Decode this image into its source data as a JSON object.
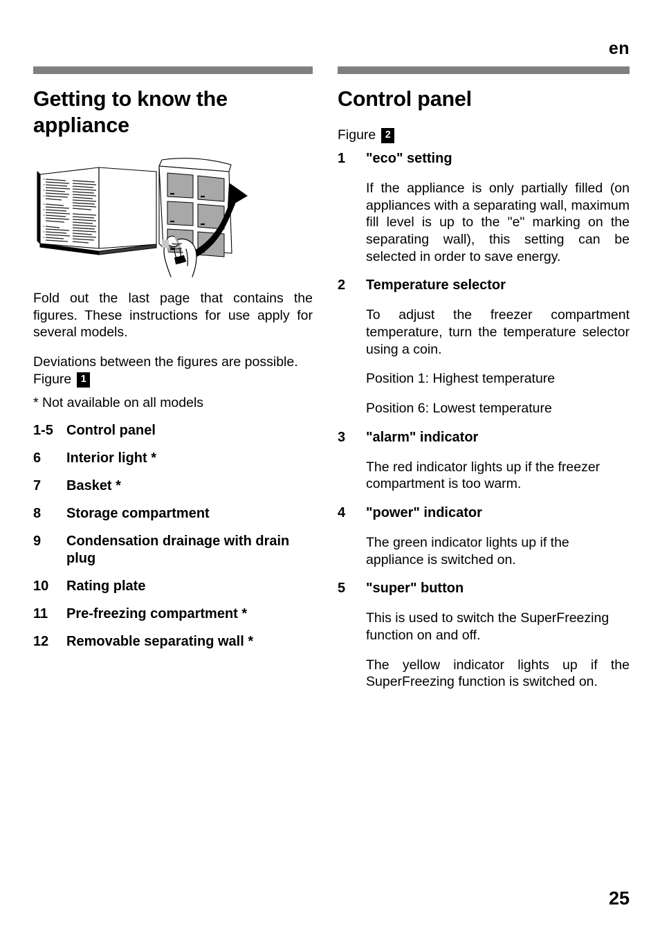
{
  "page": {
    "language_tag": "en",
    "page_number": "25",
    "rule_color": "#808080"
  },
  "left_column": {
    "title": "Getting to know the appliance",
    "illustration": {
      "name": "foldout-page-illustration",
      "description": "Open instruction booklet with a fold-out last page being pulled out by a hand, arrow pointing right"
    },
    "paragraphs": [
      "Fold out the last page that contains the figures. These instructions for use apply for several models.",
      "Deviations between the figures are possible."
    ],
    "figure_label": "Figure",
    "figure_badge": "1",
    "footnote": "* Not available on all models",
    "items": [
      {
        "num": "1-5",
        "text": "Control panel"
      },
      {
        "num": "6",
        "text": "Interior light *"
      },
      {
        "num": "7",
        "text": "Basket *"
      },
      {
        "num": "8",
        "text": "Storage compartment"
      },
      {
        "num": "9",
        "text": "Condensation drainage with drain plug"
      },
      {
        "num": "10",
        "text": "Rating plate"
      },
      {
        "num": "11",
        "text": "Pre-freezing compartment *"
      },
      {
        "num": "12",
        "text": "Removable separating wall *"
      }
    ]
  },
  "right_column": {
    "title": "Control panel",
    "figure_label": "Figure",
    "figure_badge": "2",
    "entries": [
      {
        "num": "1",
        "heading": "\"eco\" setting",
        "paragraphs": [
          "If the appliance is only partially filled (on appliances with a separating wall, maximum fill level is up to the \"e\" marking on the separating wall), this setting can be selected in order to save energy."
        ]
      },
      {
        "num": "2",
        "heading": "Temperature selector",
        "paragraphs": [
          "To adjust the freezer compartment temperature, turn the temperature selector using a coin.",
          "Position 1: Highest temperature",
          "Position 6: Lowest temperature"
        ]
      },
      {
        "num": "3",
        "heading": "\"alarm\" indicator",
        "paragraphs": [
          "The red indicator lights up if the freezer compartment is too warm."
        ]
      },
      {
        "num": "4",
        "heading": "\"power\" indicator",
        "paragraphs": [
          "The green indicator lights up if the appliance is switched on."
        ]
      },
      {
        "num": "5",
        "heading": "\"super\" button",
        "paragraphs": [
          "This is used to switch the SuperFreezing function on and off.",
          "The yellow indicator lights up if the SuperFreezing function is switched on."
        ]
      }
    ]
  }
}
